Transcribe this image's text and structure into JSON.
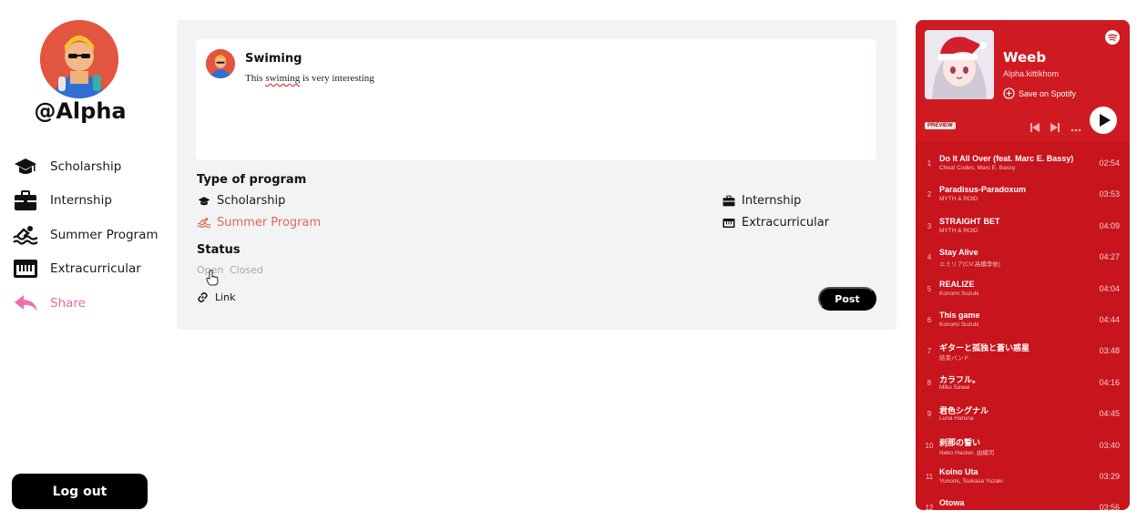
{
  "user": {
    "handle": "@Alpha"
  },
  "sidebar": {
    "items": [
      {
        "label": "Scholarship",
        "icon": "graduation-cap-icon"
      },
      {
        "label": "Internship",
        "icon": "briefcase-icon"
      },
      {
        "label": "Summer Program",
        "icon": "swimmer-icon"
      },
      {
        "label": "Extracurricular",
        "icon": "piano-icon"
      },
      {
        "label": "Share",
        "icon": "share-icon"
      }
    ],
    "logout_label": "Log out"
  },
  "post": {
    "title": "Swiming",
    "body_pre": "This ",
    "body_misspelled": "swiming",
    "body_post": " is very interesting"
  },
  "program": {
    "title": "Type of program",
    "options": [
      {
        "label": "Scholarship",
        "icon": "graduation-cap-icon",
        "selected": false
      },
      {
        "label": "Internship",
        "icon": "briefcase-icon",
        "selected": false
      },
      {
        "label": "Summer Program",
        "icon": "swimmer-icon",
        "selected": true
      },
      {
        "label": "Extracurricular",
        "icon": "piano-icon",
        "selected": false
      }
    ]
  },
  "status": {
    "title": "Status",
    "open_label": "Open",
    "closed_label": "Closed"
  },
  "link_label": "Link",
  "post_button": "Post",
  "spotify": {
    "title": "Weeb",
    "artist": "Alpha.kittikhom",
    "save_label": "Save on Spotify",
    "preview_badge": "PREVIEW",
    "tracks": [
      {
        "n": "1",
        "title": "Do It All Over (feat. Marc E. Bassy)",
        "artist": "Cheat Codes, Marc E. Bassy",
        "dur": "02:54"
      },
      {
        "n": "2",
        "title": "Paradisus-Paradoxum",
        "artist": "MYTH & ROID",
        "dur": "03:53"
      },
      {
        "n": "3",
        "title": "STRAIGHT BET",
        "artist": "MYTH & ROID",
        "dur": "04:09"
      },
      {
        "n": "4",
        "title": "Stay Alive",
        "artist": "エミリア(CV:高橋李依)",
        "dur": "04:27"
      },
      {
        "n": "5",
        "title": "REALIZE",
        "artist": "Konomi Suzuki",
        "dur": "04:04"
      },
      {
        "n": "6",
        "title": "This game",
        "artist": "Konomi Suzuki",
        "dur": "04:44"
      },
      {
        "n": "7",
        "title": "ギターと孤独と蒼い惑星",
        "artist": "結束バンド",
        "dur": "03:48"
      },
      {
        "n": "8",
        "title": "カラフル。",
        "artist": "Miku Sawai",
        "dur": "04:16"
      },
      {
        "n": "9",
        "title": "君色シグナル",
        "artist": "Luna Haruna",
        "dur": "04:45"
      },
      {
        "n": "10",
        "title": "刹那の誓い",
        "artist": "Neko Hacker, 由緒司",
        "dur": "03:40"
      },
      {
        "n": "11",
        "title": "Koino Uta",
        "artist": "Yunomi, Tsukasa Yuzaki",
        "dur": "03:29"
      },
      {
        "n": "12",
        "title": "Otowa",
        "artist": "",
        "dur": "03:56"
      }
    ]
  },
  "colors": {
    "accent_share": "#e36aa3",
    "accent_selected": "#e06a55",
    "spotify_red": "#c8141c"
  }
}
